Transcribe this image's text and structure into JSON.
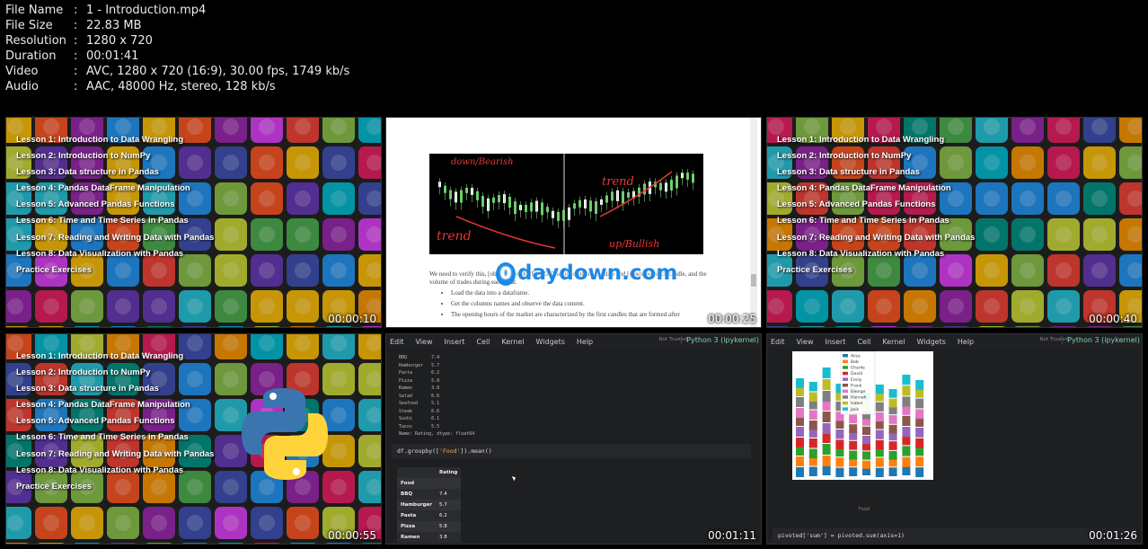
{
  "file_info": [
    {
      "key": "File Name",
      "value": "1 - Introduction.mp4"
    },
    {
      "key": "File Size",
      "value": "22.83 MB"
    },
    {
      "key": "Resolution",
      "value": "1280 x 720"
    },
    {
      "key": "Duration",
      "value": "00:01:41"
    },
    {
      "key": "Video",
      "value": "AVC, 1280 x 720 (16:9), 30.00 fps, 1749 kb/s"
    },
    {
      "key": "Audio",
      "value": "AAC, 48000 Hz, stereo, 128 kb/s"
    }
  ],
  "separator": ":",
  "lessons": [
    "Lesson 1: Introduction to Data Wrangling",
    "Lesson 2: Introduction to NumPy",
    "Lesson 3: Data structure in Pandas",
    "Lesson 4: Pandas DataFrame Manipulation",
    "Lesson 5: Advanced Pandas Functions",
    "Lesson 6: Time and Time Series in Pandas",
    "Lesson 7: Reading and Writing Data with Pandas",
    "Lesson 8: Data Visualization with Pandas",
    "Practice Exercises"
  ],
  "timecodes": [
    "00:00:10",
    "00:00:25",
    "00:00:40",
    "00:00:55",
    "00:01:11",
    "00:01:26"
  ],
  "doc": {
    "chart_label_down": "down/Bearish",
    "chart_label_trend_left": "trend",
    "chart_label_trend_right": "trend",
    "chart_label_up": "up/Bullish",
    "paragraph": "We need to verify this, [obscured] of EURUSD. The file contains the date and [obscured] each candle, and the volume of trades during each hour.",
    "bullets": [
      "Load the data into a dataframe.",
      "Get the columns names and observe the data content.",
      "The opening hours of the market are characterized by the first candles that are formed after"
    ],
    "watermark_o": "0",
    "watermark": "daydown.com"
  },
  "jupyter": {
    "menu": [
      "Edit",
      "View",
      "Insert",
      "Cell",
      "Kernel",
      "Widgets",
      "Help"
    ],
    "trusted": "Not Trusted",
    "kernel": "Python 3 (ipykernel)",
    "series_output": [
      "BBQ         7.4",
      "Hamburger   5.7",
      "Pasta       6.2",
      "Pizza       5.8",
      "Ramen       3.8",
      "Salad       6.6",
      "Seafood     5.1",
      "Steak       6.6",
      "Sushi       6.1",
      "Tacos       5.5",
      "Name: Rating, dtype: float64"
    ],
    "code_groupby_pre": "df.groupby([",
    "code_groupby_str": "'Food'",
    "code_groupby_post": "]).mean()",
    "table_header": "Rating",
    "table_index": "Food",
    "table_rows": [
      {
        "food": "BBQ",
        "rating": "7.4"
      },
      {
        "food": "Hamburger",
        "rating": "5.7"
      },
      {
        "food": "Pasta",
        "rating": "6.2"
      },
      {
        "food": "Pizza",
        "rating": "5.8"
      },
      {
        "food": "Ramen",
        "rating": "3.8"
      }
    ],
    "code_pivot_pre": "pivoted[",
    "code_pivot_str": "'sum'",
    "code_pivot_post": "] = pivoted.sum(axis=1)",
    "legend": [
      "Alice",
      "Bob",
      "Charlie",
      "David",
      "Emily",
      "Frank",
      "George",
      "Hannah",
      "Isabel",
      "Jack"
    ],
    "x_axis_label": "Food"
  },
  "colors": {
    "legend": [
      "#1f77b4",
      "#ff7f0e",
      "#2ca02c",
      "#d62728",
      "#9467bd",
      "#8c564b",
      "#e377c2",
      "#7f7f7f",
      "#bcbd22",
      "#17becf"
    ]
  }
}
